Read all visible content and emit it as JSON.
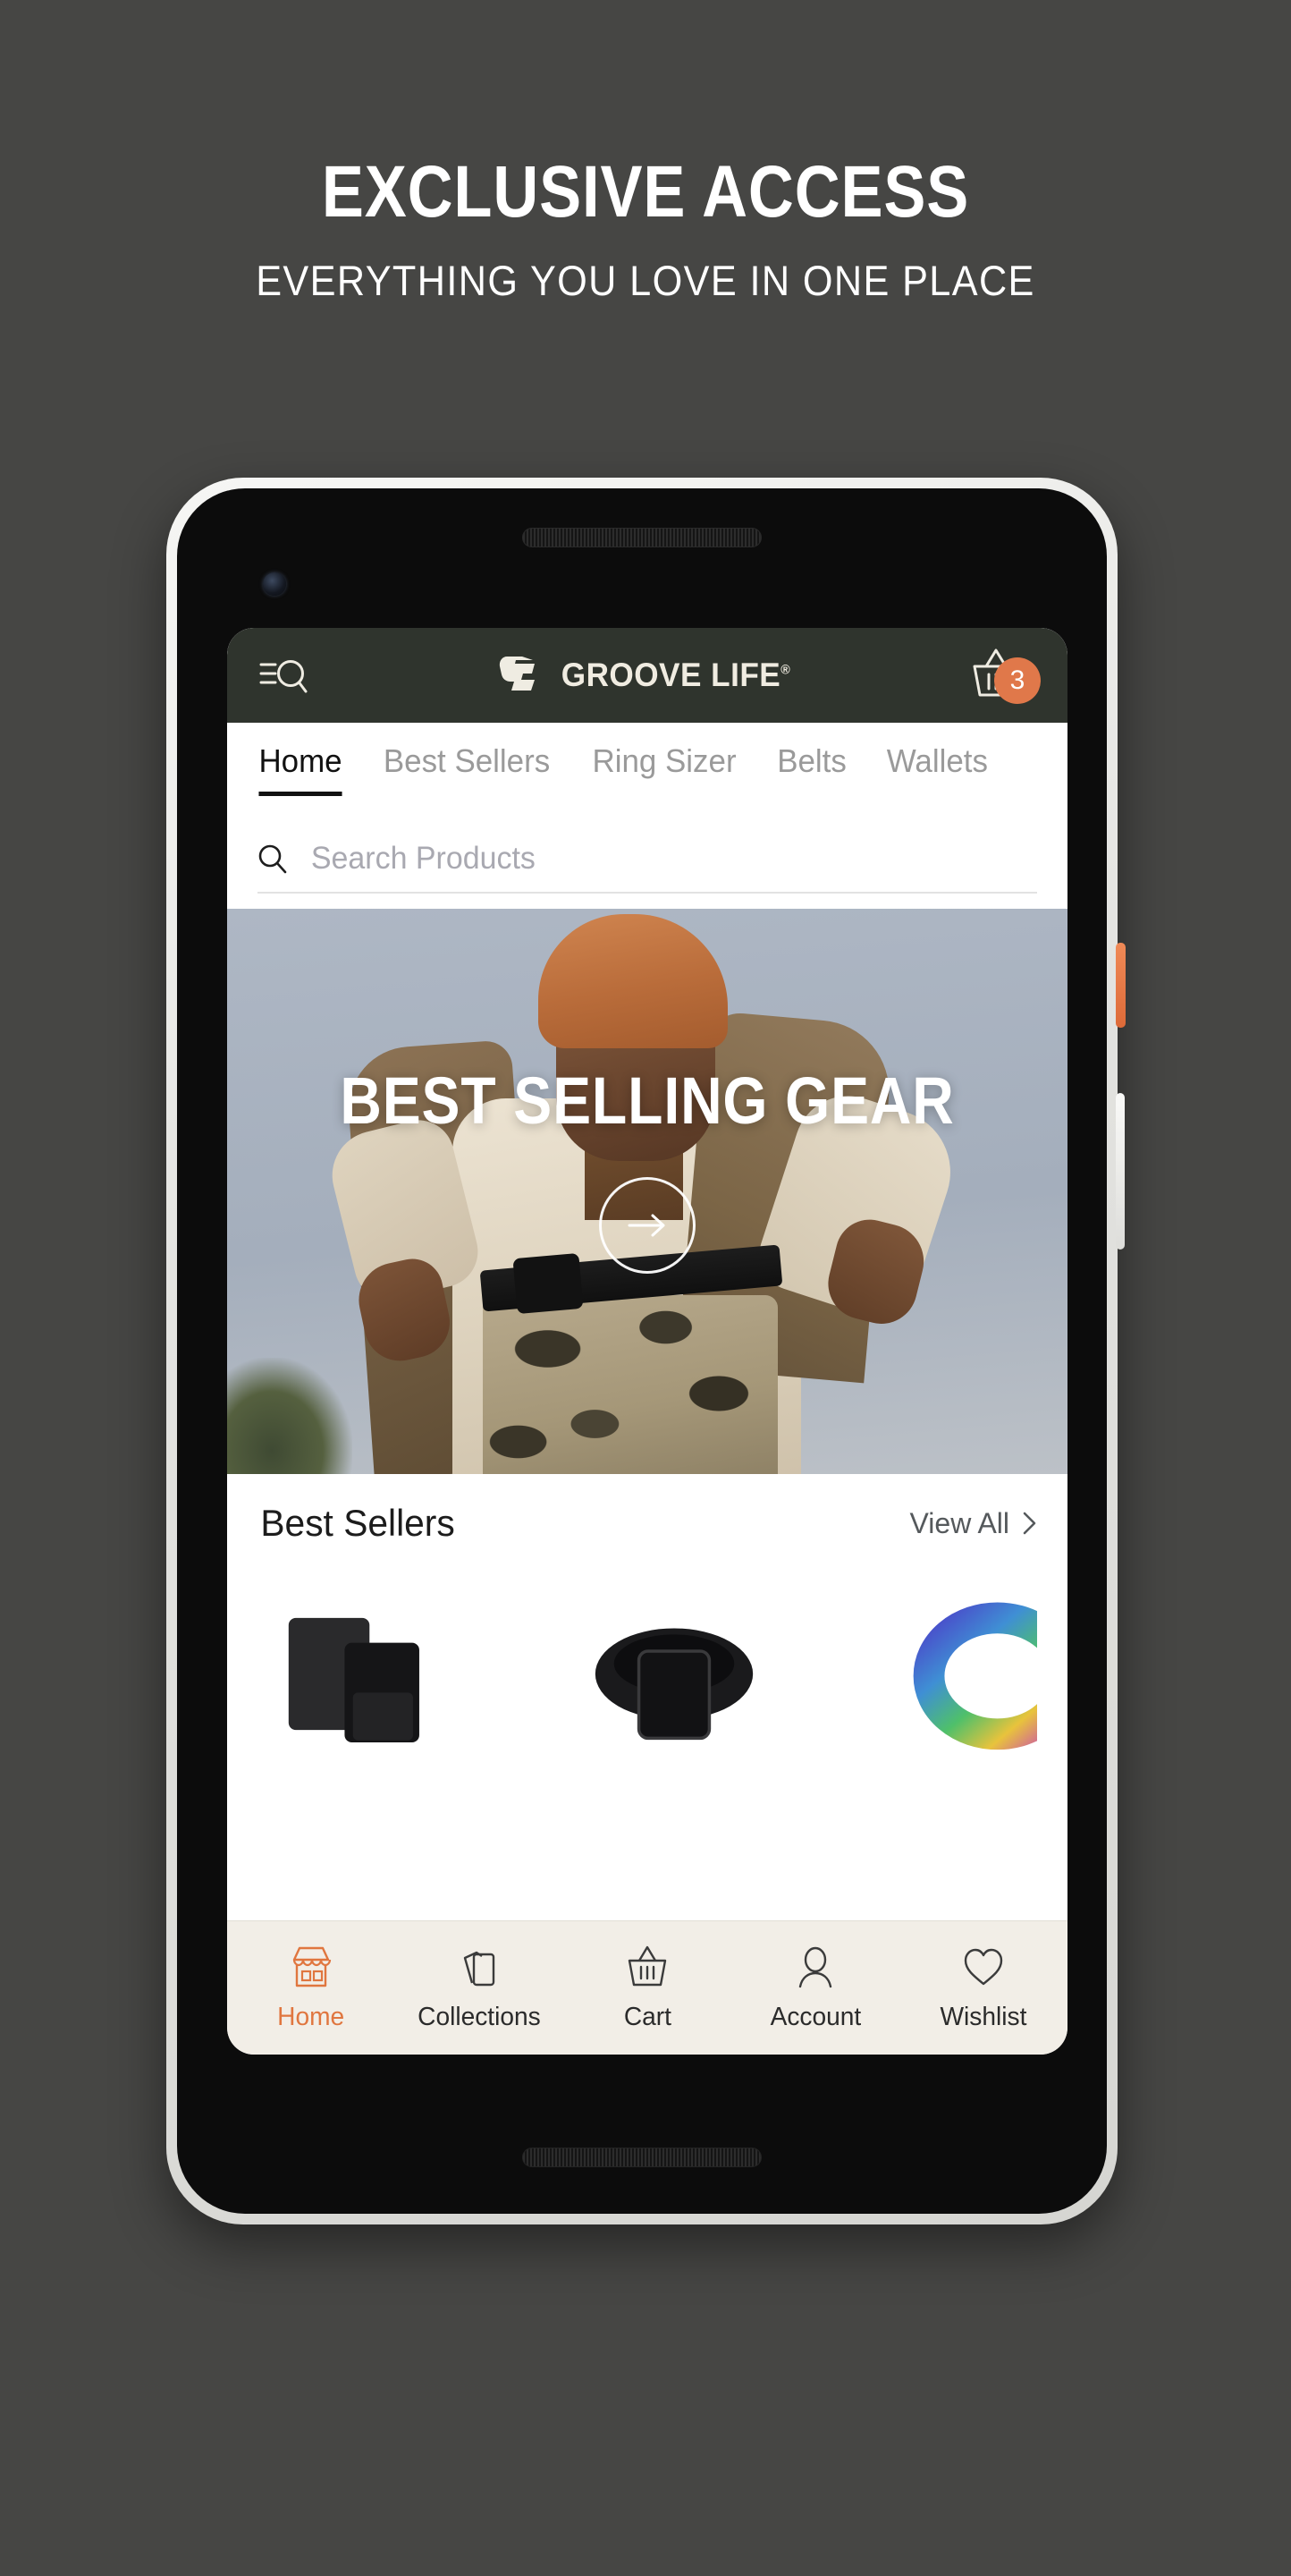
{
  "promo": {
    "title": "EXCLUSIVE ACCESS",
    "subtitle": "EVERYTHING YOU LOVE IN ONE PLACE"
  },
  "colors": {
    "page_background": "#464644",
    "appbar_background": "#2f342d",
    "accent_orange": "#e0784a",
    "tabbar_background": "#f2eee7",
    "active_tab_text": "#e0763f"
  },
  "app": {
    "appbar": {
      "menu_search_icon": "menu-search-icon",
      "brand_mark": "gl-monogram-icon",
      "brand_name": "GROOVE LIFE",
      "brand_registered": "®",
      "cart_icon": "basket-icon",
      "cart_count": "3"
    },
    "category_tabs": [
      {
        "label": "Home",
        "active": true
      },
      {
        "label": "Best Sellers",
        "active": false
      },
      {
        "label": "Ring Sizer",
        "active": false
      },
      {
        "label": "Belts",
        "active": false
      },
      {
        "label": "Wallets",
        "active": false
      }
    ],
    "search": {
      "icon": "search-icon",
      "placeholder": "Search Products",
      "value": ""
    },
    "hero": {
      "headline": "BEST SELLING GEAR",
      "cta_icon": "arrow-right-icon"
    },
    "best_sellers": {
      "title": "Best Sellers",
      "view_all_label": "View All",
      "view_all_icon": "chevron-right-icon",
      "products": [
        {
          "name": "black-wallet"
        },
        {
          "name": "black-belt"
        },
        {
          "name": "colorful-ring"
        }
      ]
    },
    "bottom_nav": [
      {
        "label": "Home",
        "icon": "storefront-icon",
        "active": true
      },
      {
        "label": "Collections",
        "icon": "cards-icon",
        "active": false
      },
      {
        "label": "Cart",
        "icon": "basket-icon",
        "active": false
      },
      {
        "label": "Account",
        "icon": "person-icon",
        "active": false
      },
      {
        "label": "Wishlist",
        "icon": "heart-icon",
        "active": false
      }
    ]
  },
  "device": {
    "power_button": "power-button",
    "volume_button": "volume-rocker",
    "earpiece": "earpiece-speaker",
    "front_camera": "front-camera",
    "bottom_speaker": "bottom-speaker"
  }
}
